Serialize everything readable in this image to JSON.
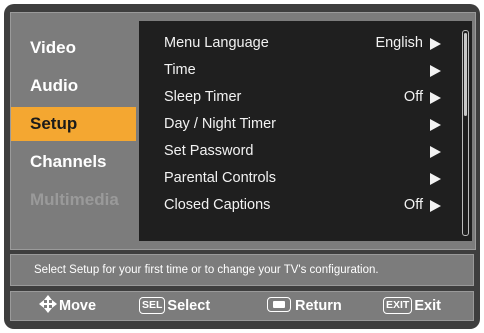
{
  "sidebar": {
    "items": [
      {
        "label": "Video",
        "state": "normal"
      },
      {
        "label": "Audio",
        "state": "normal"
      },
      {
        "label": "Setup",
        "state": "active"
      },
      {
        "label": "Channels",
        "state": "normal"
      },
      {
        "label": "Multimedia",
        "state": "disabled"
      }
    ]
  },
  "menu": {
    "rows": [
      {
        "label": "Menu Language",
        "value": "English",
        "icon": "arrow-right-icon"
      },
      {
        "label": "Time",
        "value": "",
        "icon": "arrow-right-icon"
      },
      {
        "label": "Sleep Timer",
        "value": "Off",
        "icon": "arrow-right-icon"
      },
      {
        "label": "Day / Night Timer",
        "value": "",
        "icon": "arrow-right-icon"
      },
      {
        "label": "Set Password",
        "value": "",
        "icon": "arrow-right-icon"
      },
      {
        "label": "Parental Controls",
        "value": "",
        "icon": "arrow-right-icon"
      },
      {
        "label": "Closed Captions",
        "value": "Off",
        "icon": "arrow-right-icon"
      }
    ],
    "scroll_fraction_visible": 0.4
  },
  "help_text": "Select Setup for your first time or to change your TV's configuration.",
  "footer": {
    "move_label": "Move",
    "select_key": "SEL",
    "select_label": "Select",
    "return_label": "Return",
    "exit_key": "EXIT",
    "exit_label": "Exit"
  },
  "colors": {
    "highlight": "#f4a731",
    "panel": "#1f1f1f",
    "frame": "#3e3e3e",
    "chrome": "#7c7c7c"
  }
}
